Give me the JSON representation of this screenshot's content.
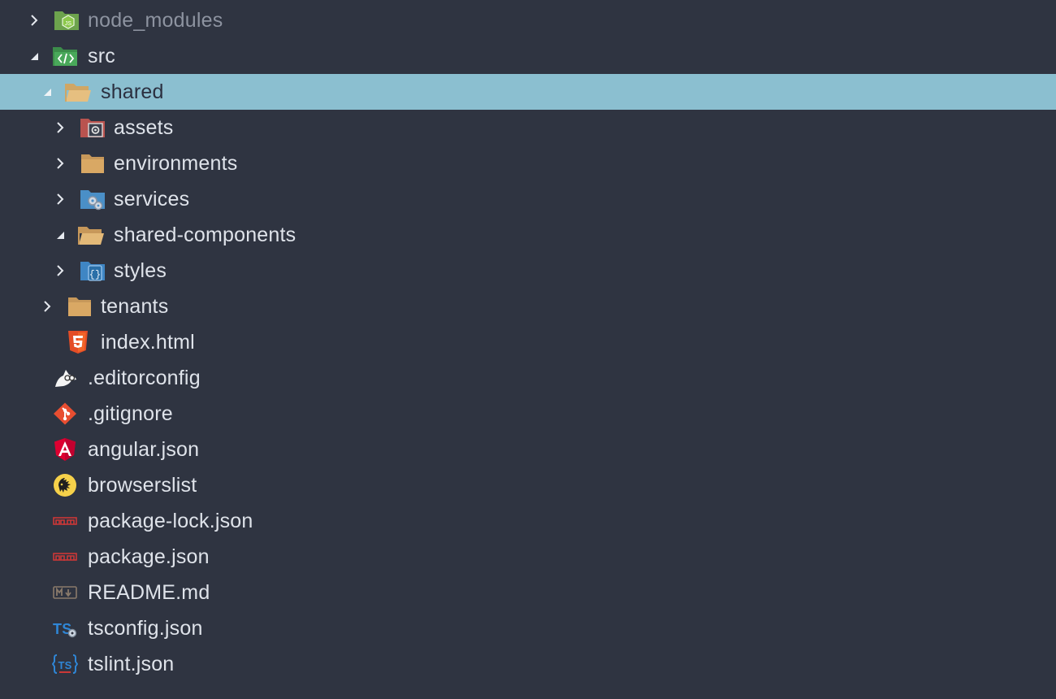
{
  "explorer": {
    "items": [
      {
        "label": "node_modules",
        "icon": "node-folder-icon",
        "arrow": "collapsed"
      },
      {
        "label": "src",
        "icon": "src-folder-icon",
        "arrow": "expanded"
      },
      {
        "label": "shared",
        "icon": "open-folder-icon",
        "arrow": "expanded",
        "selected": true
      },
      {
        "label": "assets",
        "icon": "assets-folder-icon",
        "arrow": "collapsed"
      },
      {
        "label": "environments",
        "icon": "folder-icon",
        "arrow": "collapsed"
      },
      {
        "label": "services",
        "icon": "services-folder-icon",
        "arrow": "collapsed"
      },
      {
        "label": "shared-components",
        "icon": "open-folder-icon",
        "arrow": "expanded"
      },
      {
        "label": "styles",
        "icon": "styles-folder-icon",
        "arrow": "collapsed"
      },
      {
        "label": "tenants",
        "icon": "folder-icon",
        "arrow": "collapsed"
      },
      {
        "label": "index.html",
        "icon": "html5-icon",
        "arrow": "none"
      },
      {
        "label": ".editorconfig",
        "icon": "editorconfig-icon",
        "arrow": "none"
      },
      {
        "label": ".gitignore",
        "icon": "git-icon",
        "arrow": "none"
      },
      {
        "label": "angular.json",
        "icon": "angular-icon",
        "arrow": "none"
      },
      {
        "label": "browserslist",
        "icon": "browserslist-icon",
        "arrow": "none"
      },
      {
        "label": "package-lock.json",
        "icon": "npm-icon",
        "arrow": "none"
      },
      {
        "label": "package.json",
        "icon": "npm-icon",
        "arrow": "none"
      },
      {
        "label": "README.md",
        "icon": "markdown-icon",
        "arrow": "none"
      },
      {
        "label": "tsconfig.json",
        "icon": "tsconfig-icon",
        "arrow": "none"
      },
      {
        "label": "tslint.json",
        "icon": "tslint-icon",
        "arrow": "none"
      }
    ]
  },
  "colors": {
    "background": "#2f3441",
    "selection": "#8bbfd0",
    "text": "#dfe3ea",
    "muted_text": "#8d93a0"
  }
}
